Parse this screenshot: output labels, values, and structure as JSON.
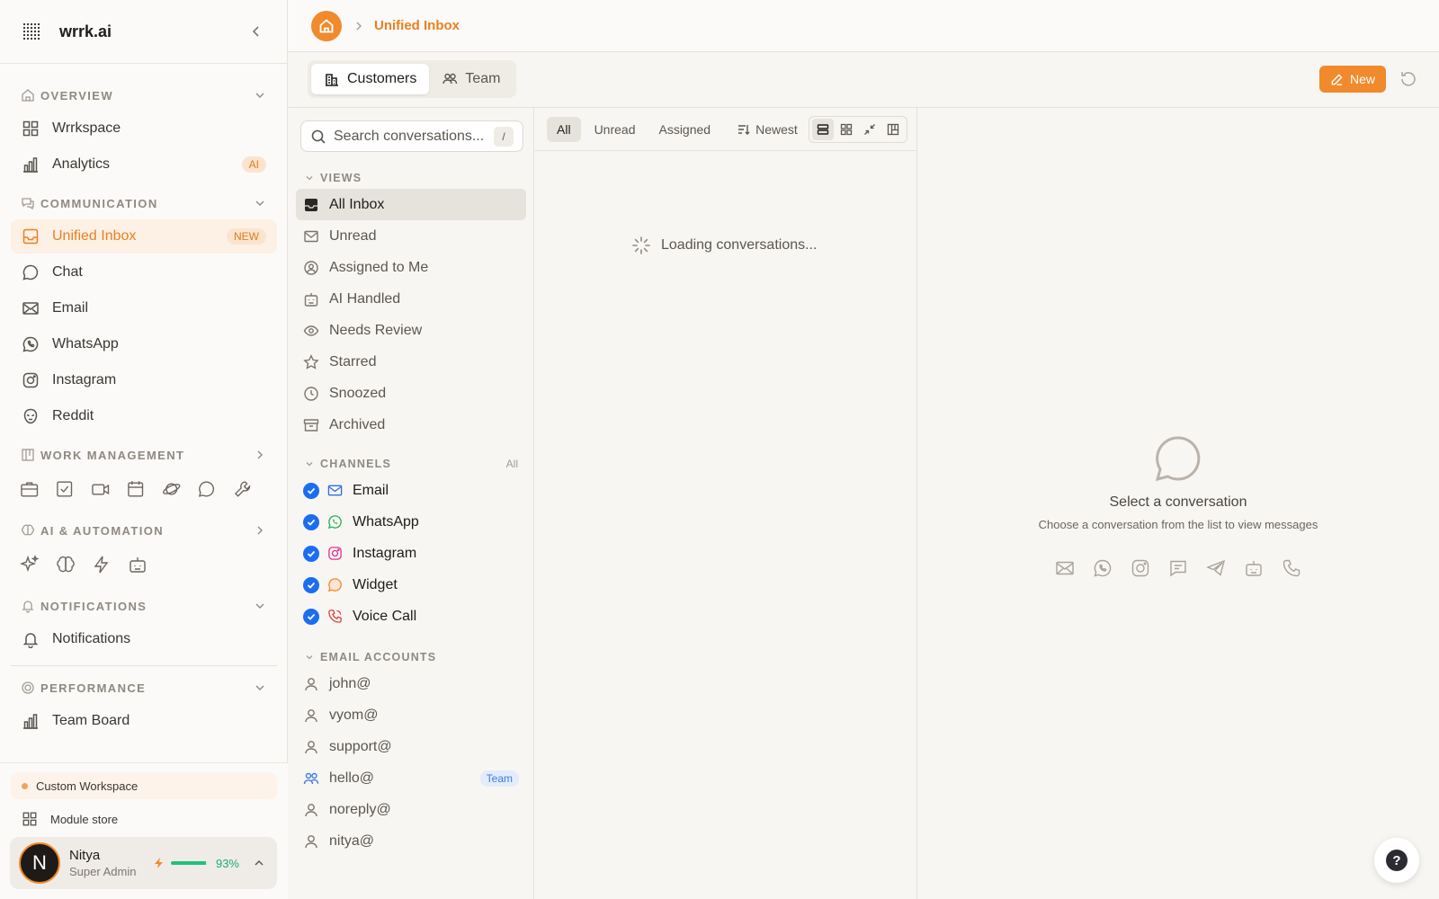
{
  "app": {
    "name": "wrrk.ai"
  },
  "sidebar": {
    "overview": {
      "title": "OVERVIEW",
      "items": [
        {
          "label": "Wrrkspace"
        },
        {
          "label": "Analytics",
          "badge": "AI"
        }
      ]
    },
    "communication": {
      "title": "COMMUNICATION",
      "items": [
        {
          "label": "Unified Inbox",
          "badge": "NEW"
        },
        {
          "label": "Chat"
        },
        {
          "label": "Email"
        },
        {
          "label": "WhatsApp"
        },
        {
          "label": "Instagram"
        },
        {
          "label": "Reddit"
        }
      ]
    },
    "work_management": {
      "title": "WORK MANAGEMENT"
    },
    "ai_automation": {
      "title": "AI & AUTOMATION"
    },
    "notifications": {
      "title": "NOTIFICATIONS",
      "items": [
        {
          "label": "Notifications"
        }
      ]
    },
    "performance": {
      "title": "PERFORMANCE",
      "items": [
        {
          "label": "Team Board"
        }
      ]
    },
    "custom_workspace": "Custom Workspace",
    "module_store": "Module store",
    "user": {
      "initial": "N",
      "name": "Nitya",
      "role": "Super Admin",
      "usage_percent": 93,
      "usage_text": "93%"
    }
  },
  "header": {
    "breadcrumb": "Unified Inbox"
  },
  "subbar": {
    "tabs": [
      {
        "label": "Customers"
      },
      {
        "label": "Team"
      }
    ],
    "new_label": "New"
  },
  "views_panel": {
    "search_placeholder": "Search conversations...",
    "shortcut": "/",
    "views_title": "VIEWS",
    "views": [
      {
        "label": "All Inbox"
      },
      {
        "label": "Unread"
      },
      {
        "label": "Assigned to Me"
      },
      {
        "label": "AI Handled"
      },
      {
        "label": "Needs Review"
      },
      {
        "label": "Starred"
      },
      {
        "label": "Snoozed"
      },
      {
        "label": "Archived"
      }
    ],
    "channels_title": "CHANNELS",
    "channels_all": "All",
    "channels": [
      {
        "label": "Email"
      },
      {
        "label": "WhatsApp"
      },
      {
        "label": "Instagram"
      },
      {
        "label": "Widget"
      },
      {
        "label": "Voice Call"
      }
    ],
    "email_title": "EMAIL ACCOUNTS",
    "email_accounts": [
      {
        "label": "john@"
      },
      {
        "label": "vyom@"
      },
      {
        "label": "support@"
      },
      {
        "label": "hello@",
        "tag": "Team"
      },
      {
        "label": "noreply@"
      },
      {
        "label": "nitya@"
      }
    ]
  },
  "conv_list": {
    "filters": [
      {
        "label": "All"
      },
      {
        "label": "Unread"
      },
      {
        "label": "Assigned"
      }
    ],
    "sort_label": "Newest",
    "loading_text": "Loading conversations..."
  },
  "detail": {
    "empty_title": "Select a conversation",
    "empty_subtitle": "Choose a conversation from the list to view messages"
  },
  "colors": {
    "accent": "#f08a2c",
    "check": "#1b6df2",
    "success": "#22c07d"
  }
}
